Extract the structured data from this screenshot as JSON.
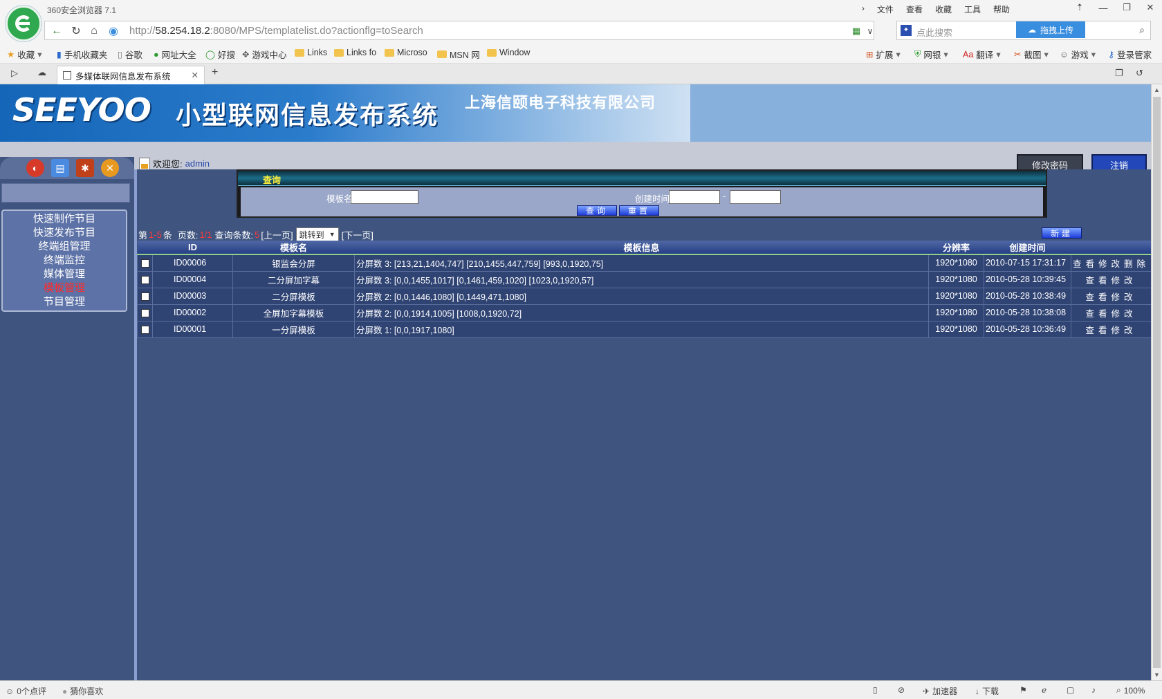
{
  "browser": {
    "name": "360安全浏览器 7.1",
    "menu": [
      "文件",
      "查看",
      "收藏",
      "工具",
      "帮助"
    ],
    "url_prefix": "http://",
    "url_host": "58.254.18.2",
    "url_rest": ":8080/MPS/templatelist.do?actionflg=toSearch",
    "search_placeholder": "点此搜索",
    "upload_label": "拖拽上传",
    "bookmarks": [
      "收藏",
      "手机收藏夹",
      "谷歌",
      "网址大全",
      "好搜",
      "游戏中心",
      "Links",
      "Links fo",
      "Microso",
      "MSN 网",
      "Window"
    ],
    "toolbar_right": [
      "扩展",
      "网银",
      "翻译",
      "截图",
      "游戏",
      "登录管家"
    ],
    "tab_title": "多媒体联网信息发布系统",
    "status_left": [
      "0个点评",
      "猜你喜欢"
    ],
    "status_right": {
      "accelerator": "加速器",
      "download": "下载",
      "zoom": "100%"
    }
  },
  "header": {
    "brand": "SEEYOO",
    "system_title": "小型联网信息发布系统",
    "company": "上海信颐电子科技有限公司",
    "welcome": "欢迎您:",
    "user": "admin",
    "change_password": "修改密码",
    "logout": "注销"
  },
  "sidebar": {
    "menu": [
      {
        "label": "快速制作节目",
        "active": false
      },
      {
        "label": "快速发布节目",
        "active": false
      },
      {
        "label": "终端组管理",
        "active": false
      },
      {
        "label": "终端监控",
        "active": false
      },
      {
        "label": "媒体管理",
        "active": false
      },
      {
        "label": "模板管理",
        "active": true
      },
      {
        "label": "节目管理",
        "active": false
      }
    ]
  },
  "query": {
    "title": "查询",
    "template_name_label": "模板名",
    "created_time_label": "创建时间",
    "range_sep": "-",
    "search_button": "查询",
    "reset_button": "重置"
  },
  "pager": {
    "prefix": "第",
    "range": "1-5",
    "item_suffix": "条",
    "pages_label": "页数:",
    "pages": "1/1",
    "count_label": "查询条数:",
    "count": "5",
    "prev": "[上一页]",
    "jump_label": "跳转到",
    "next": "[下一页]",
    "new_button": "新建"
  },
  "table": {
    "headers": [
      "",
      "ID",
      "模板名",
      "模板信息",
      "分辨率",
      "创建时间",
      ""
    ],
    "rows": [
      {
        "id": "ID00006",
        "name": "银监会分屏",
        "info": "分屏数 3: [213,21,1404,747] [210,1455,447,759] [993,0,1920,75]",
        "res": "1920*1080",
        "time": "2010-07-15 17:31:17",
        "actions": [
          "查",
          "看",
          "修",
          "改",
          "删",
          "除"
        ]
      },
      {
        "id": "ID00004",
        "name": "二分屏加字幕",
        "info": "分屏数 3: [0,0,1455,1017] [0,1461,459,1020] [1023,0,1920,57]",
        "res": "1920*1080",
        "time": "2010-05-28 10:39:45",
        "actions": [
          "查",
          "看",
          "修",
          "改"
        ]
      },
      {
        "id": "ID00003",
        "name": "二分屏模板",
        "info": "分屏数 2: [0,0,1446,1080] [0,1449,471,1080]",
        "res": "1920*1080",
        "time": "2010-05-28 10:38:49",
        "actions": [
          "查",
          "看",
          "修",
          "改"
        ]
      },
      {
        "id": "ID00002",
        "name": "全屏加字幕模板",
        "info": "分屏数 2: [0,0,1914,1005] [1008,0,1920,72]",
        "res": "1920*1080",
        "time": "2010-05-28 10:38:08",
        "actions": [
          "查",
          "看",
          "修",
          "改"
        ]
      },
      {
        "id": "ID00001",
        "name": "一分屏模板",
        "info": "分屏数 1: [0,0,1917,1080]",
        "res": "1920*1080",
        "time": "2010-05-28 10:36:49",
        "actions": [
          "查",
          "看",
          "修",
          "改"
        ]
      }
    ]
  },
  "colors": {
    "app_bg": "#3f547f",
    "active_menu": "#ff2a2a",
    "query_title": "#ffef3a"
  }
}
